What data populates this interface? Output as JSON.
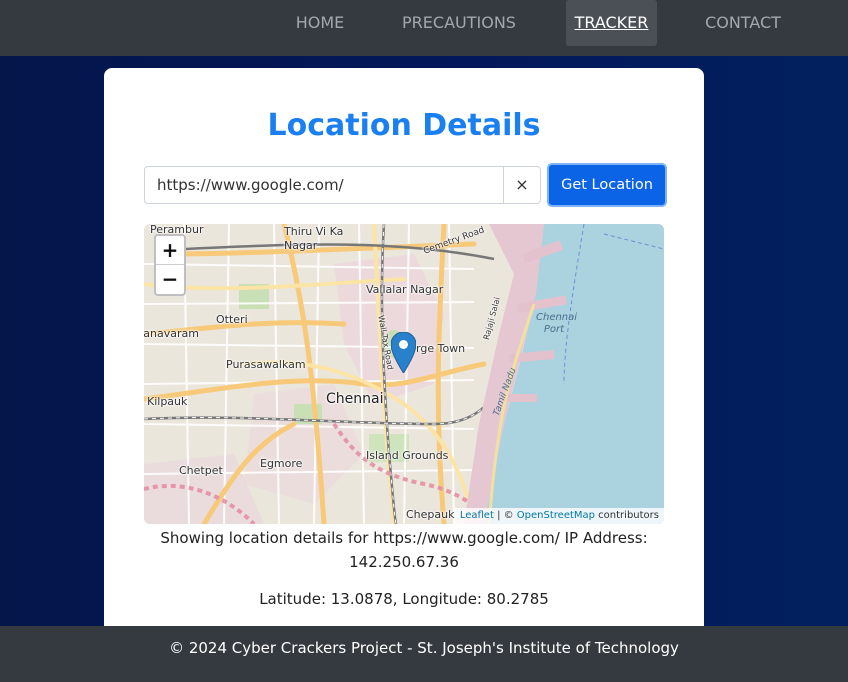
{
  "nav": {
    "items": [
      {
        "label": "HOME"
      },
      {
        "label": "PRECAUTIONS"
      },
      {
        "label": "TRACKER"
      },
      {
        "label": "CONTACT"
      }
    ],
    "active": "TRACKER"
  },
  "main": {
    "title": "Location Details",
    "search": {
      "value": "https://www.google.com/",
      "clear_label": "×",
      "button_label": "Get Location"
    },
    "map": {
      "zoom_in": "+",
      "zoom_out": "−",
      "attribution": {
        "leaflet": "Leaflet",
        "separator": " | © ",
        "osm": "OpenStreetMap",
        "suffix": " contributors"
      },
      "labels": [
        "Perambur",
        "Thiru Vi Ka Nagar",
        "Cemetry Road",
        "Vallalar Nagar",
        "Otteri",
        "Chennai Port",
        "Ayanavaram",
        "George Town",
        "Purasawalkam",
        "Kilpauk",
        "Chennai",
        "Chetpet",
        "Egmore",
        "Island Grounds",
        "Chepauk",
        "Wall Tax Road",
        "Rajaji Salai",
        "Tamil Nadu"
      ]
    },
    "info_line": "Showing location details for https://www.google.com/ IP Address: 142.250.67.36",
    "coords_line": "Latitude: 13.0878, Longitude: 80.2785"
  },
  "footer": {
    "text": "© 2024 Cyber Crackers Project - St. Joseph's Institute of Technology"
  },
  "colors": {
    "navbar": "#343a40",
    "accent": "#1a7ff0",
    "button": "#0b63e5",
    "background": "#03185a"
  }
}
